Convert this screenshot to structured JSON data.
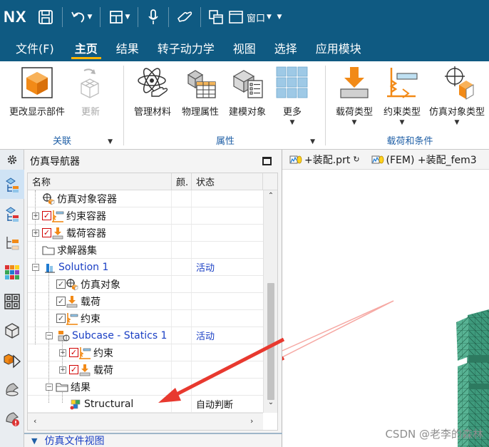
{
  "app": {
    "logo": "NX",
    "window_menu_label": "窗口"
  },
  "menu": {
    "tabs": [
      {
        "label": "文件(F)"
      },
      {
        "label": "主页"
      },
      {
        "label": "结果"
      },
      {
        "label": "转子动力学"
      },
      {
        "label": "视图"
      },
      {
        "label": "选择"
      },
      {
        "label": "应用模块"
      }
    ],
    "active_index": 1
  },
  "ribbon": {
    "groups": [
      {
        "title": "关联",
        "items": [
          {
            "label": "更改显示部件",
            "icon": "orange-cube-icon"
          },
          {
            "label": "更新",
            "icon": "update-mesh-icon",
            "disabled": true
          }
        ]
      },
      {
        "title": "属性",
        "items": [
          {
            "label": "管理材料",
            "icon": "atom-hand-icon"
          },
          {
            "label": "物理属性",
            "icon": "physical-table-icon"
          },
          {
            "label": "建模对象",
            "icon": "modeling-object-icon"
          },
          {
            "label": "更多",
            "icon": "grid-more-icon"
          }
        ]
      },
      {
        "title": "载荷和条件",
        "items": [
          {
            "label": "载荷类型",
            "icon": "load-arrow-icon"
          },
          {
            "label": "约束类型",
            "icon": "constraint-icon"
          },
          {
            "label": "仿真对象类型",
            "icon": "sim-object-icon"
          }
        ]
      }
    ]
  },
  "navigator": {
    "title": "仿真导航器",
    "columns": {
      "name": "名称",
      "color": "颜.",
      "status": "状态"
    },
    "rows": [
      {
        "label": "仿真对象容器",
        "status": ""
      },
      {
        "label": "约束容器",
        "status": ""
      },
      {
        "label": "载荷容器",
        "status": ""
      },
      {
        "label": "求解器集",
        "status": ""
      },
      {
        "label": "Solution 1",
        "status": "活动"
      },
      {
        "label": "仿真对象",
        "status": ""
      },
      {
        "label": "载荷",
        "status": ""
      },
      {
        "label": "约束",
        "status": ""
      },
      {
        "label": "Subcase - Statics 1",
        "status": "活动"
      },
      {
        "label": "约束",
        "status": ""
      },
      {
        "label": "载荷",
        "status": ""
      },
      {
        "label": "结果",
        "status": ""
      },
      {
        "label": "Structural",
        "status": "自动判断"
      }
    ],
    "footer_title": "仿真文件视图"
  },
  "graphics": {
    "tabs": [
      {
        "label": "+装配.prt"
      },
      {
        "label": "(FEM) +装配_fem3"
      }
    ],
    "watermark": "CSDN @老李的森林"
  },
  "colors": {
    "titlebar": "#0f5a82",
    "accent": "#ffb400",
    "tree_link": "#1a3fc4",
    "annotation_arrow": "#e8392f",
    "mesh": "#3e9a7c"
  }
}
